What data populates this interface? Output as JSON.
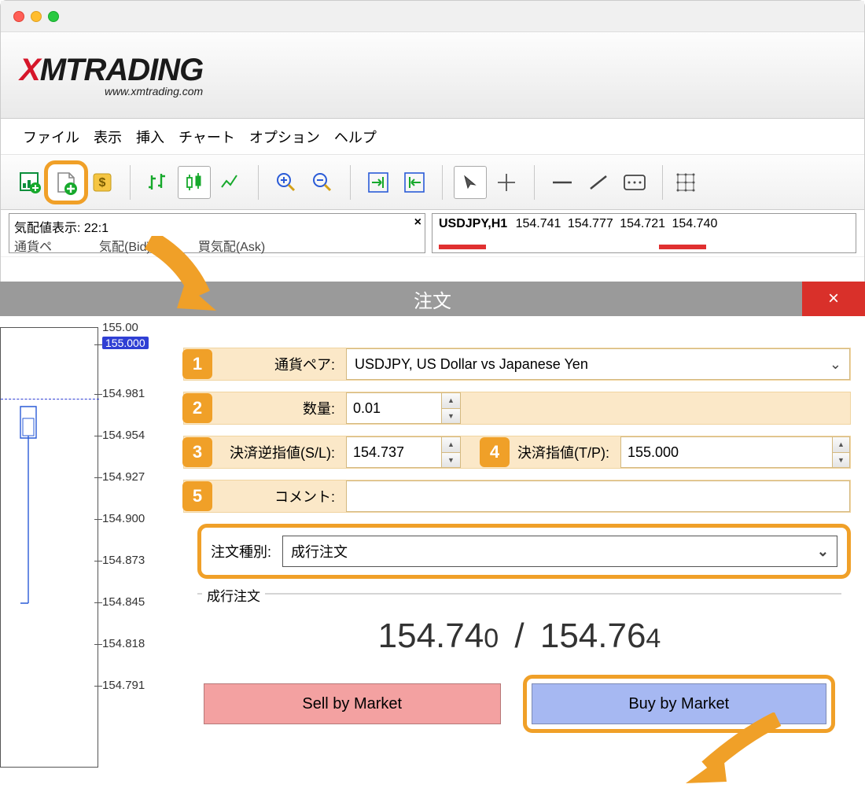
{
  "window": {
    "title": "XMTRADING",
    "url": "www.xmtrading.com"
  },
  "menu": {
    "file": "ファイル",
    "view": "表示",
    "insert": "挿入",
    "chart": "チャート",
    "option": "オプション",
    "help": "ヘルプ"
  },
  "quote_panel": {
    "title": "気配値表示: 22:1",
    "row_partial_left": "通貨ペ",
    "row_partial_mid": "気配(Bid)",
    "row_partial_right": "買気配(Ask)"
  },
  "chart_tab": {
    "symbol": "USDJPY,H1",
    "ohlc": [
      "154.741",
      "154.777",
      "154.721",
      "154.740"
    ]
  },
  "dialog": {
    "title": "注文",
    "close": "×",
    "fields": {
      "pair_label": "通貨ペア:",
      "pair_value": "USDJPY, US Dollar vs Japanese Yen",
      "volume_label": "数量:",
      "volume_value": "0.01",
      "sl_label": "決済逆指値(S/L):",
      "sl_value": "154.737",
      "tp_label": "決済指値(T/P):",
      "tp_value": "155.000",
      "comment_label": "コメント:",
      "ordertype_label": "注文種別:",
      "ordertype_value": "成行注文"
    },
    "market": {
      "section_label": "成行注文",
      "bid_main": "154.74",
      "bid_small": "0",
      "sep": "/",
      "ask_main": "154.76",
      "ask_small": "4",
      "sell_label": "Sell by Market",
      "buy_label": "Buy by Market"
    },
    "badges": {
      "n1": "1",
      "n2": "2",
      "n3": "3",
      "n4": "4",
      "n5": "5"
    }
  },
  "y_axis": {
    "a": "155.00",
    "a_badge": "155.000",
    "b": "154.981",
    "c": "154.954",
    "d": "154.927",
    "e": "154.900",
    "f": "154.873",
    "g": "154.845",
    "h": "154.818",
    "i": "154.791"
  }
}
